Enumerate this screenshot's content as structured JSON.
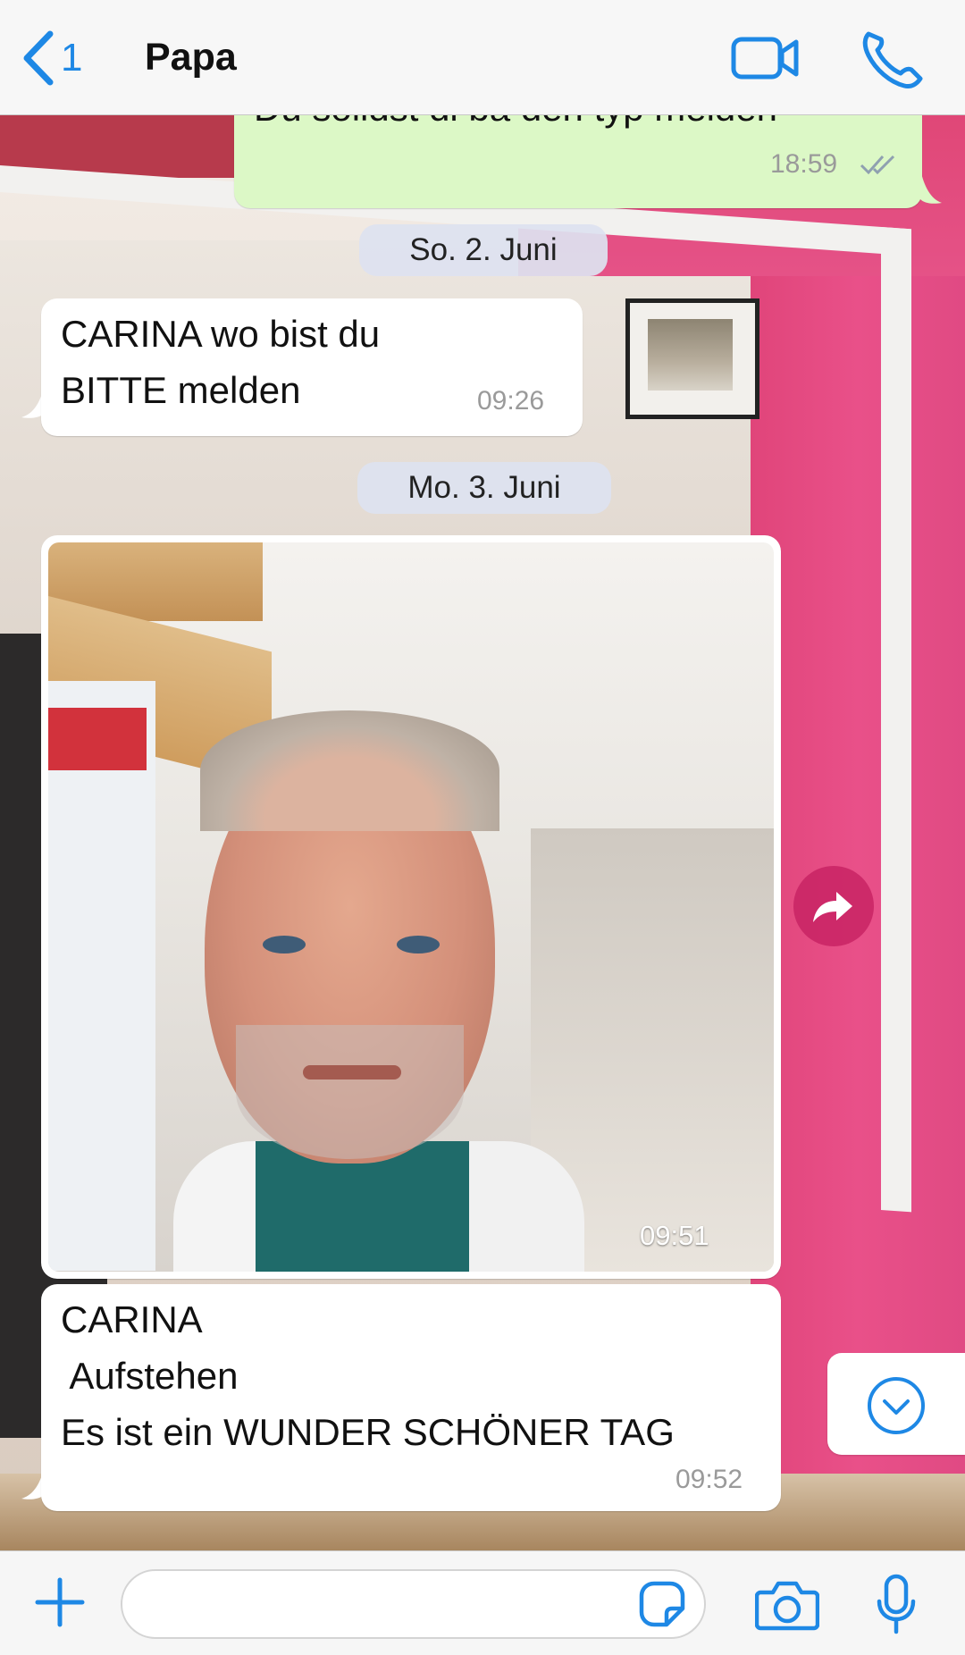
{
  "header": {
    "back_count": "1",
    "contact_name": "Papa",
    "accent_color": "#1e88e5",
    "icons": [
      "chevron-left-icon",
      "video-call-icon",
      "phone-call-icon"
    ]
  },
  "messages": [
    {
      "direction": "outgoing",
      "text": "Du solldst di ba den typ melden",
      "time": "18:59",
      "status": "read"
    },
    {
      "type": "date",
      "text": "So. 2. Juni"
    },
    {
      "direction": "incoming",
      "text": "CARINA wo bist du\nBITTE melden",
      "time": "09:26"
    },
    {
      "type": "date",
      "text": "Mo. 3. Juni"
    },
    {
      "direction": "incoming",
      "type": "photo",
      "time": "09:51"
    },
    {
      "direction": "incoming",
      "text": "CARINA\n Aufstehen\nEs ist ein WUNDER SCHÖNER TAG",
      "time": "09:52"
    }
  ],
  "input": {
    "placeholder": "",
    "icons": [
      "plus-icon",
      "sticker-icon",
      "camera-icon",
      "microphone-icon"
    ]
  },
  "colors": {
    "outgoing_bubble": "#dcf8c6",
    "incoming_bubble": "#ffffff",
    "forward_button": "#c82364"
  }
}
